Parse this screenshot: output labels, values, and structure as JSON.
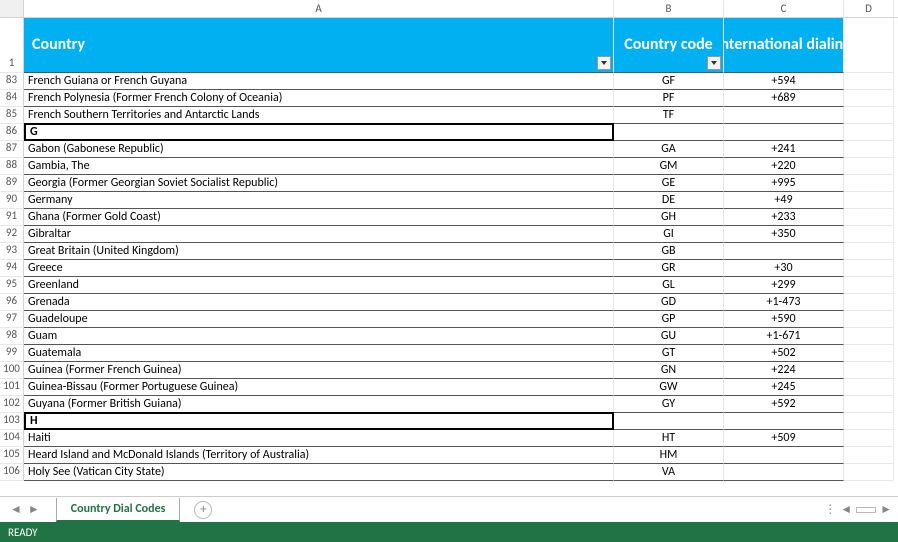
{
  "status_text": "READY",
  "sheet_tab": "Country Dial Codes",
  "columns": {
    "A": "A",
    "B": "B",
    "C": "C",
    "D": "D"
  },
  "header": {
    "rownum": "1",
    "country": "Country",
    "code": "Country code",
    "dial": "International dialing"
  },
  "rows": [
    {
      "n": "83",
      "country": "French Guiana or French Guyana",
      "code": "GF",
      "dial": "+594"
    },
    {
      "n": "84",
      "country": "French Polynesia (Former French Colony of Oceania)",
      "code": "PF",
      "dial": "+689"
    },
    {
      "n": "85",
      "country": "French Southern Territories and Antarctic Lands",
      "code": "TF",
      "dial": ""
    },
    {
      "n": "86",
      "country": "G",
      "code": "",
      "dial": "",
      "section": true
    },
    {
      "n": "87",
      "country": "Gabon (Gabonese Republic)",
      "code": "GA",
      "dial": "+241"
    },
    {
      "n": "88",
      "country": "Gambia, The",
      "code": "GM",
      "dial": "+220"
    },
    {
      "n": "89",
      "country": "Georgia (Former Georgian Soviet Socialist Republic)",
      "code": "GE",
      "dial": "+995"
    },
    {
      "n": "90",
      "country": "Germany",
      "code": "DE",
      "dial": "+49"
    },
    {
      "n": "91",
      "country": "Ghana (Former Gold Coast)",
      "code": "GH",
      "dial": "+233"
    },
    {
      "n": "92",
      "country": "Gibraltar",
      "code": "GI",
      "dial": "+350"
    },
    {
      "n": "93",
      "country": "Great Britain (United Kingdom)",
      "code": "GB",
      "dial": ""
    },
    {
      "n": "94",
      "country": "Greece",
      "code": "GR",
      "dial": "+30"
    },
    {
      "n": "95",
      "country": "Greenland",
      "code": "GL",
      "dial": "+299"
    },
    {
      "n": "96",
      "country": "Grenada",
      "code": "GD",
      "dial": "+1-473"
    },
    {
      "n": "97",
      "country": "Guadeloupe",
      "code": "GP",
      "dial": "+590"
    },
    {
      "n": "98",
      "country": "Guam",
      "code": "GU",
      "dial": "+1-671"
    },
    {
      "n": "99",
      "country": "Guatemala",
      "code": "GT",
      "dial": "+502"
    },
    {
      "n": "100",
      "country": "Guinea (Former French Guinea)",
      "code": "GN",
      "dial": "+224"
    },
    {
      "n": "101",
      "country": "Guinea-Bissau (Former Portuguese Guinea)",
      "code": "GW",
      "dial": "+245"
    },
    {
      "n": "102",
      "country": "Guyana (Former British Guiana)",
      "code": "GY",
      "dial": "+592"
    },
    {
      "n": "103",
      "country": "H",
      "code": "",
      "dial": "",
      "section": true
    },
    {
      "n": "104",
      "country": "Haiti",
      "code": "HT",
      "dial": "+509"
    },
    {
      "n": "105",
      "country": "Heard Island and McDonald Islands (Territory of Australia)",
      "code": "HM",
      "dial": ""
    },
    {
      "n": "106",
      "country": "Holy See (Vatican City State)",
      "code": "VA",
      "dial": ""
    }
  ],
  "chart_data": {
    "type": "table",
    "columns": [
      "Country",
      "Country code",
      "International dialing"
    ],
    "rows": [
      [
        "French Guiana or French Guyana",
        "GF",
        "+594"
      ],
      [
        "French Polynesia (Former French Colony of Oceania)",
        "PF",
        "+689"
      ],
      [
        "French Southern Territories and Antarctic Lands",
        "TF",
        ""
      ],
      [
        "G",
        "",
        ""
      ],
      [
        "Gabon (Gabonese Republic)",
        "GA",
        "+241"
      ],
      [
        "Gambia, The",
        "GM",
        "+220"
      ],
      [
        "Georgia (Former Georgian Soviet Socialist Republic)",
        "GE",
        "+995"
      ],
      [
        "Germany",
        "DE",
        "+49"
      ],
      [
        "Ghana (Former Gold Coast)",
        "GH",
        "+233"
      ],
      [
        "Gibraltar",
        "GI",
        "+350"
      ],
      [
        "Great Britain (United Kingdom)",
        "GB",
        ""
      ],
      [
        "Greece",
        "GR",
        "+30"
      ],
      [
        "Greenland",
        "GL",
        "+299"
      ],
      [
        "Grenada",
        "GD",
        "+1-473"
      ],
      [
        "Guadeloupe",
        "GP",
        "+590"
      ],
      [
        "Guam",
        "GU",
        "+1-671"
      ],
      [
        "Guatemala",
        "GT",
        "+502"
      ],
      [
        "Guinea (Former French Guinea)",
        "GN",
        "+224"
      ],
      [
        "Guinea-Bissau (Former Portuguese Guinea)",
        "GW",
        "+245"
      ],
      [
        "Guyana (Former British Guiana)",
        "GY",
        "+592"
      ],
      [
        "H",
        "",
        ""
      ],
      [
        "Haiti",
        "HT",
        "+509"
      ],
      [
        "Heard Island and McDonald Islands (Territory of Australia)",
        "HM",
        ""
      ],
      [
        "Holy See (Vatican City State)",
        "VA",
        ""
      ]
    ]
  }
}
